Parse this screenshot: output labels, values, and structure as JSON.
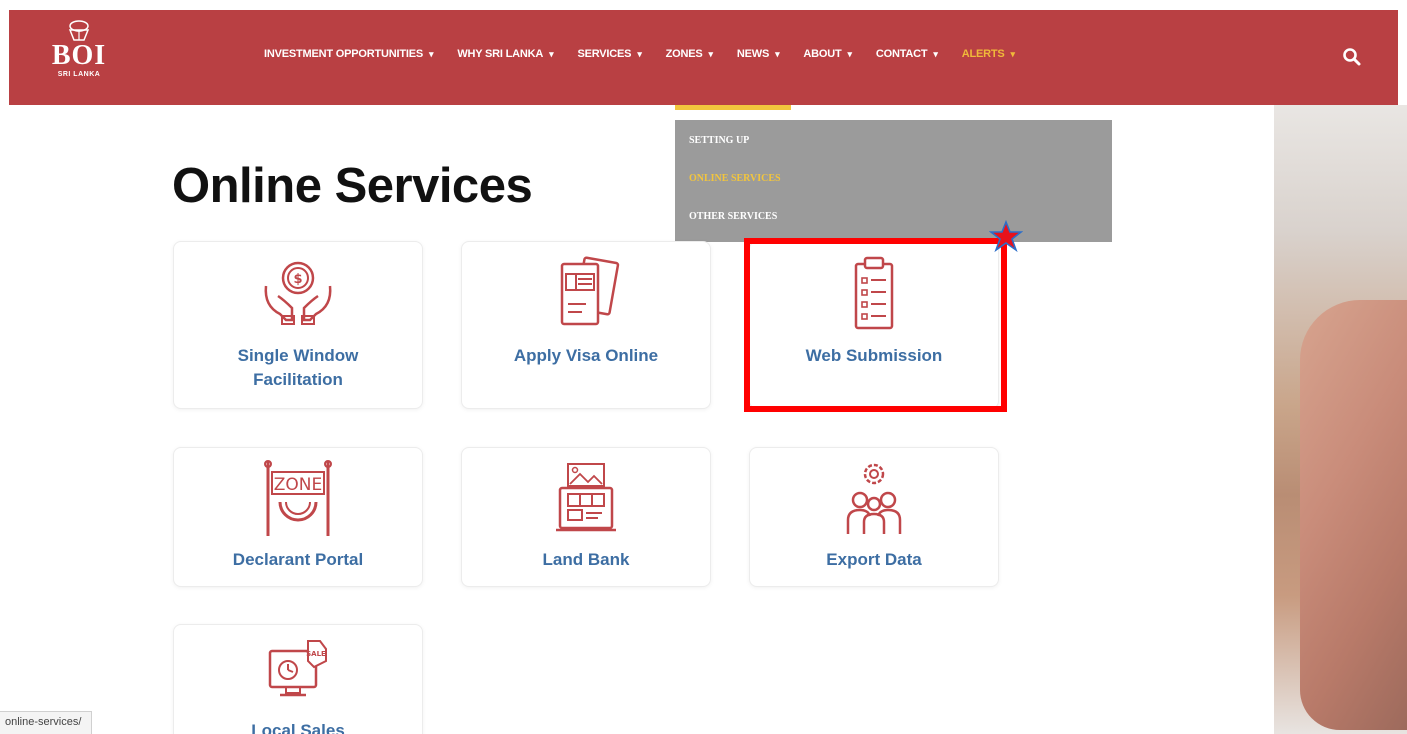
{
  "header": {
    "logo_text": "BOI",
    "logo_sub": "SRI LANKA",
    "nav": [
      {
        "label": "INVESTMENT OPPORTUNITIES"
      },
      {
        "label": "WHY SRI LANKA"
      },
      {
        "label": "SERVICES"
      },
      {
        "label": "ZONES"
      },
      {
        "label": "NEWS"
      },
      {
        "label": "ABOUT"
      },
      {
        "label": "CONTACT"
      },
      {
        "label": "ALERTS"
      }
    ],
    "caret": "▾"
  },
  "dropdown": {
    "items": [
      "SETTING UP",
      "ONLINE SERVICES",
      "OTHER SERVICES"
    ],
    "active": "ONLINE SERVICES"
  },
  "main": {
    "title": "Online Services",
    "cards": [
      {
        "label_line1": "Single Window",
        "label_line2": "Facilitation",
        "icon": "money-hands-icon"
      },
      {
        "label_line1": "Apply Visa Online",
        "icon": "visa-document-icon"
      },
      {
        "label_line1": "Web Submission",
        "icon": "clipboard-list-icon"
      },
      {
        "label_line1": "Declarant Portal",
        "icon": "zone-sign-icon"
      },
      {
        "label_line1": "Land Bank",
        "icon": "land-bank-icon"
      },
      {
        "label_line1": "Export Data",
        "icon": "team-gear-icon"
      },
      {
        "label_line1": "Local Sales",
        "icon": "sale-monitor-icon"
      }
    ]
  },
  "status_bar": {
    "url": "online-services/"
  },
  "colors": {
    "header": "#b94043",
    "accent_yellow": "#f2c53d",
    "label_blue": "#3d6ea3",
    "icon_red": "#c0474a",
    "highlight": "#ff0000"
  }
}
